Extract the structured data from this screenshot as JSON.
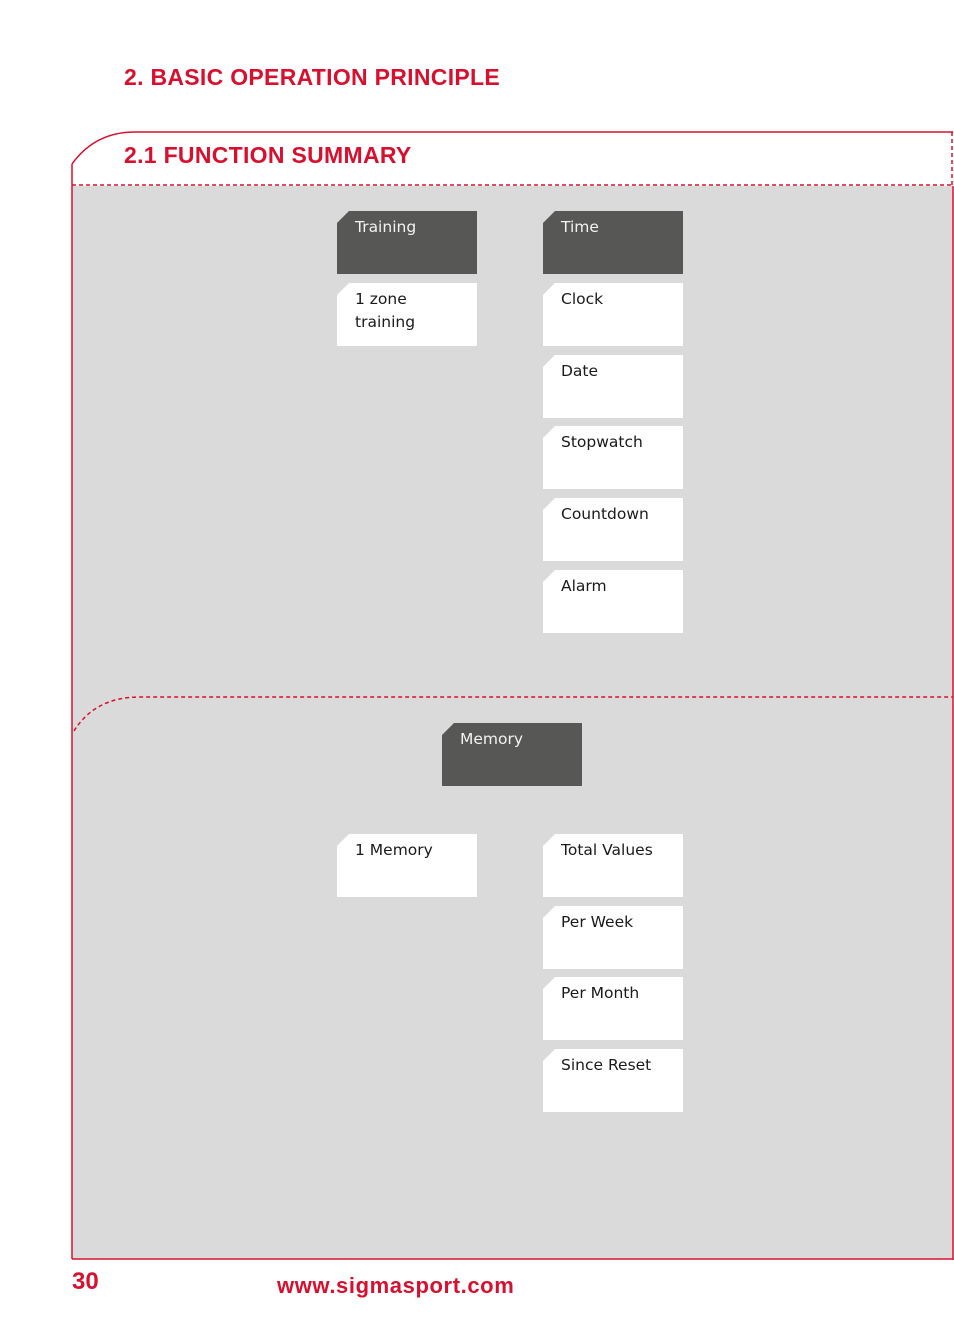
{
  "header": {
    "chapter_title": "2. BASIC OPERATION PRINCIPLE",
    "section_title": "2.1 FUNCTION SUMMARY"
  },
  "colors": {
    "accent": "#d7102f",
    "panel_background": "#dadada",
    "category_box": "#575756",
    "item_box": "#ffffff"
  },
  "section_top": {
    "columns": [
      {
        "category": "Training",
        "items": [
          "1 zone training"
        ]
      },
      {
        "category": "Time",
        "items": [
          "Clock",
          "Date",
          "Stopwatch",
          "Countdown",
          "Alarm"
        ]
      }
    ]
  },
  "section_bottom": {
    "category": "Memory",
    "left_items": [
      "1 Memory"
    ],
    "right_items": [
      "Total Values",
      "Per Week",
      "Per Month",
      "Since Reset"
    ]
  },
  "footer": {
    "page_number": "30",
    "website": "www.sigmasport.com"
  }
}
